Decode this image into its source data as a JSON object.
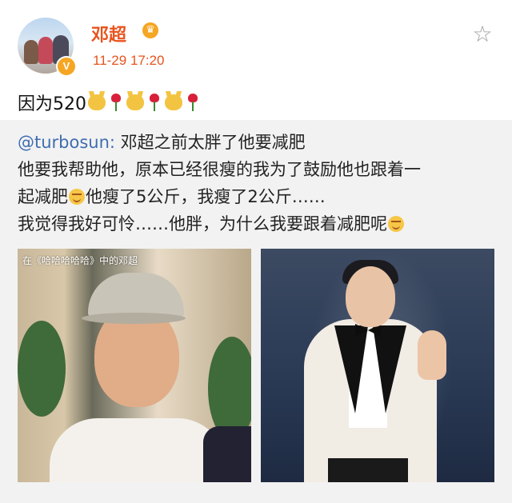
{
  "post": {
    "username": "邓超",
    "timestamp": "11-29 17:20",
    "verified_badge": "V",
    "crown_icon": "crown-icon",
    "favorite_icon": "star-outline-icon",
    "text": "因为520"
  },
  "repost": {
    "mention": "@turbosun:",
    "line1": " 邓超之前太胖了他要减肥",
    "line2": "他要我帮助他，原本已经很瘦的我为了鼓励他也跟着一",
    "line3a": "起减肥",
    "line3b": "他瘦了5公斤，我瘦了2公斤……",
    "line4": "我觉得我好可怜……他胖，为什么我要跟着减肥呢",
    "photos": [
      {
        "caption": "在《哈哈哈哈哈》中的邓超"
      },
      {
        "caption": ""
      }
    ]
  },
  "colors": {
    "accent": "#e8541e",
    "mention": "#3f6db0",
    "repost_bg": "#f2f2f2"
  }
}
